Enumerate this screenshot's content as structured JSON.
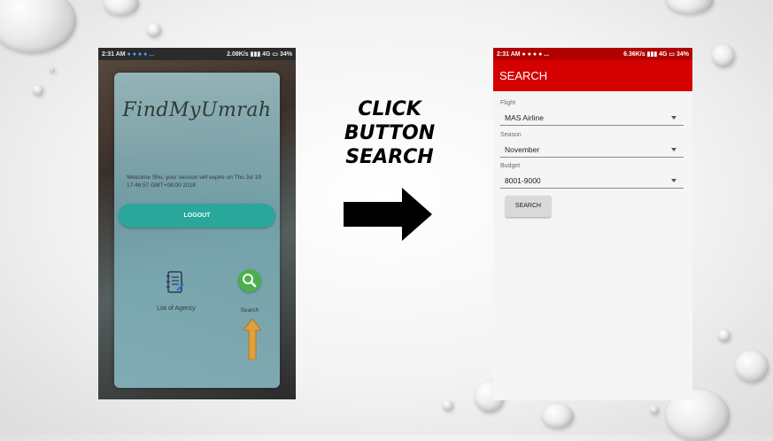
{
  "instruction": {
    "line1": "CLICK BUTTON",
    "line2": "SEARCH"
  },
  "left_screen": {
    "statusbar": {
      "time": "2:31 AM",
      "speed": "2.08K/s",
      "network": "4G",
      "battery": "34%"
    },
    "brand": "FindMyUmrah",
    "welcome_text": "Welcome Shu, your session will expire on Thu Jul 19 17:46:57 GMT+08:00 2018",
    "logout_label": "LOGOUT",
    "menu": [
      {
        "label": "List of Agency",
        "icon": "notebook-icon"
      },
      {
        "label": "Search",
        "icon": "search-icon"
      }
    ],
    "colors": {
      "logout": "#2aa79b",
      "search_icon": "#4caf50",
      "arrow": "#e0a040"
    }
  },
  "right_screen": {
    "statusbar": {
      "time": "2:31 AM",
      "speed": "6.36K/s",
      "network": "4G",
      "battery": "34%"
    },
    "appbar_title": "SEARCH",
    "fields": [
      {
        "label": "Flight",
        "value": "MAS Airline"
      },
      {
        "label": "Season",
        "value": "November"
      },
      {
        "label": "Budget",
        "value": "8001-9000"
      }
    ],
    "search_button": "SEARCH",
    "colors": {
      "appbar": "#d50000"
    }
  }
}
